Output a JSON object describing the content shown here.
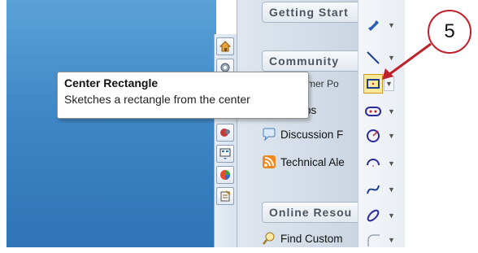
{
  "panel": {
    "sections": [
      {
        "label": "Getting Start"
      },
      {
        "label": "Community"
      },
      {
        "label": "Online Resou"
      }
    ],
    "links": [
      {
        "label": "Groups"
      },
      {
        "label": "Discussion F"
      },
      {
        "label": "Technical Ale"
      },
      {
        "label": "Find Custom"
      }
    ],
    "partial_link_text": "mer Po"
  },
  "tabs": [
    {
      "icon": "home-icon"
    },
    {
      "icon": "tools-icon"
    },
    {
      "icon": "design-library-icon"
    },
    {
      "icon": "file-explorer-icon"
    },
    {
      "icon": "view-palette-icon"
    },
    {
      "icon": "appearances-icon"
    },
    {
      "icon": "custom-properties-icon"
    }
  ],
  "toolbar": {
    "tools": [
      {
        "icon": "smart-dimension-icon"
      },
      {
        "icon": "line-icon"
      },
      {
        "icon": "center-rectangle-icon"
      },
      {
        "icon": "slot-icon"
      },
      {
        "icon": "circle-icon"
      },
      {
        "icon": "arc-icon"
      },
      {
        "icon": "spline-icon"
      },
      {
        "icon": "ellipse-icon"
      },
      {
        "icon": "fillet-icon"
      }
    ],
    "dropdown_glyph": "▼"
  },
  "tooltip": {
    "title": "Center Rectangle",
    "description": "Sketches a rectangle from the center"
  },
  "callout": {
    "number": "5"
  },
  "colors": {
    "callout_red": "#c0202a",
    "active_highlight": "#fde89a",
    "desktop_blue": "#3f88c7"
  }
}
